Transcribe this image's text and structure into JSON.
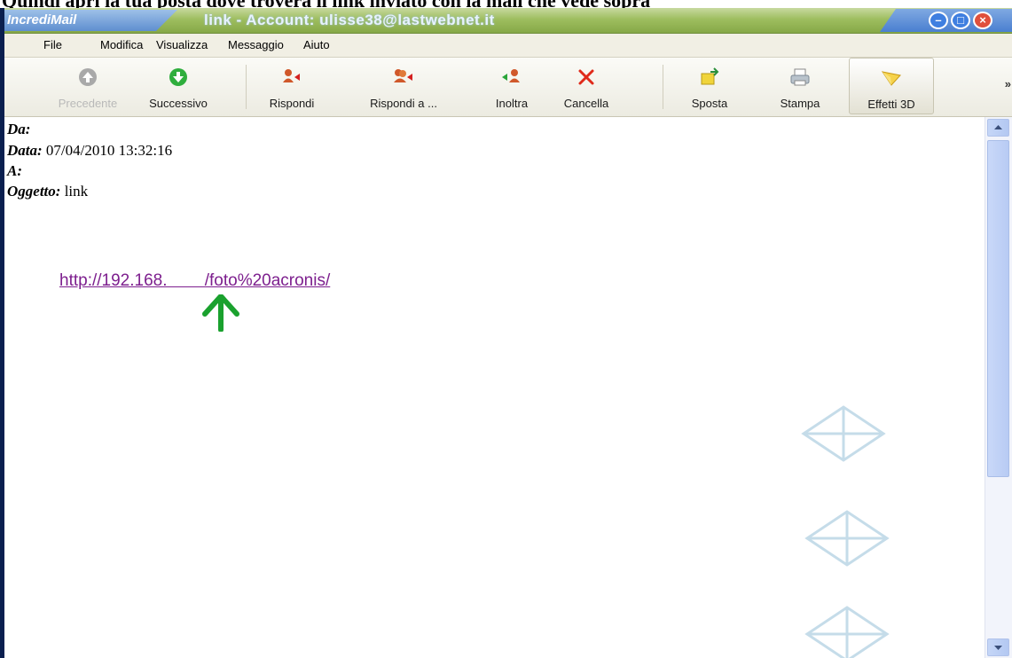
{
  "caption": "Quindi apri la tua posta dove trovera il link inviato con la mail che vede sopra",
  "window": {
    "logo": "IncrediMail",
    "title": "link - Account: ulisse38@lastwebnet.it"
  },
  "menu": [
    "File",
    "Modifica",
    "Visualizza",
    "Messaggio",
    "Aiuto"
  ],
  "toolbar": {
    "buttons": [
      {
        "label": "Precedente",
        "icon": "up-arrow-icon",
        "enabled": false
      },
      {
        "label": "Successivo",
        "icon": "down-arrow-icon",
        "enabled": true
      },
      {
        "label": "Rispondi",
        "icon": "reply-icon",
        "enabled": true
      },
      {
        "label": "Rispondi a ...",
        "icon": "reply-all-icon",
        "enabled": true
      },
      {
        "label": "Inoltra",
        "icon": "forward-icon",
        "enabled": true
      },
      {
        "label": "Cancella",
        "icon": "delete-icon",
        "enabled": true
      },
      {
        "label": "Sposta",
        "icon": "move-icon",
        "enabled": true
      },
      {
        "label": "Stampa",
        "icon": "print-icon",
        "enabled": true
      },
      {
        "label": "Effetti 3D",
        "icon": "effects-3d-icon",
        "enabled": true
      }
    ],
    "more": "»"
  },
  "message": {
    "from_label": "Da:",
    "from_value": "",
    "date_label": "Data:",
    "date_value": "07/04/2010 13:32:16",
    "to_label": "A:",
    "to_value": "",
    "subject_label": "Oggetto:",
    "subject_value": "link",
    "link": "http://192.168.        /foto%20acronis/"
  },
  "colors": {
    "link": "#7d1f8e",
    "arrow": "#1aa12e",
    "titlebar": "#9ebe5f"
  }
}
